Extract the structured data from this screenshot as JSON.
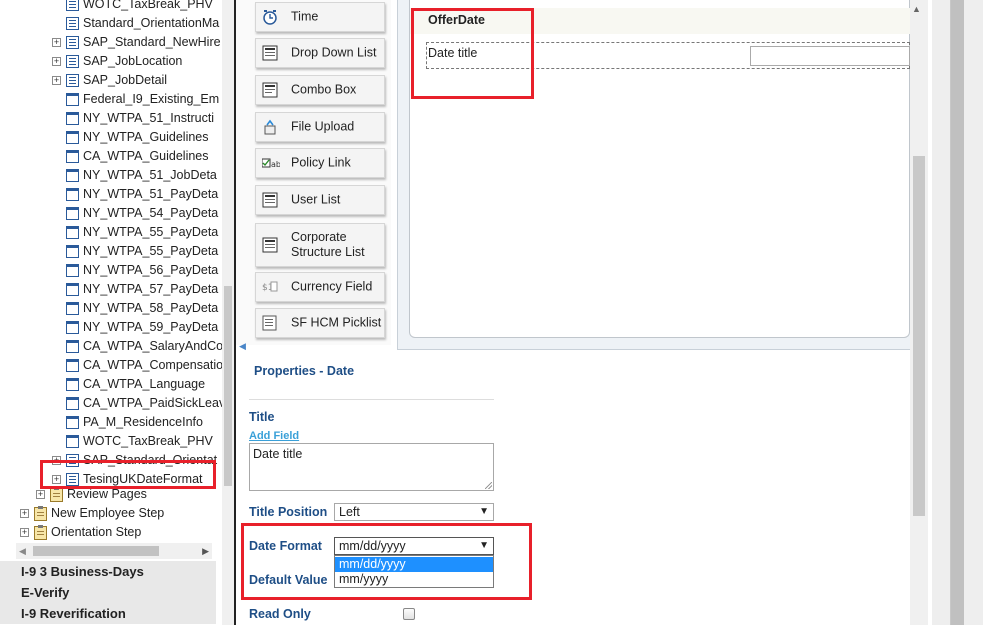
{
  "tree": {
    "items": [
      {
        "label": "WOTC_TaxBreak_PHV",
        "expander": false,
        "icon": "lined"
      },
      {
        "label": "Standard_OrientationMa",
        "expander": false,
        "icon": "lined"
      },
      {
        "label": "SAP_Standard_NewHire",
        "expander": true,
        "icon": "lined"
      },
      {
        "label": "SAP_JobLocation",
        "expander": true,
        "icon": "lined"
      },
      {
        "label": "SAP_JobDetail",
        "expander": true,
        "icon": "lined"
      },
      {
        "label": "Federal_I9_Existing_Em",
        "expander": false,
        "icon": "plain"
      },
      {
        "label": "NY_WTPA_51_Instructi",
        "expander": false,
        "icon": "plain"
      },
      {
        "label": "NY_WTPA_Guidelines",
        "expander": false,
        "icon": "plain"
      },
      {
        "label": "CA_WTPA_Guidelines",
        "expander": false,
        "icon": "plain"
      },
      {
        "label": "NY_WTPA_51_JobDeta",
        "expander": false,
        "icon": "plain"
      },
      {
        "label": "NY_WTPA_51_PayDeta",
        "expander": false,
        "icon": "plain"
      },
      {
        "label": "NY_WTPA_54_PayDeta",
        "expander": false,
        "icon": "plain"
      },
      {
        "label": "NY_WTPA_55_PayDeta",
        "expander": false,
        "icon": "plain"
      },
      {
        "label": "NY_WTPA_55_PayDeta",
        "expander": false,
        "icon": "plain"
      },
      {
        "label": "NY_WTPA_56_PayDeta",
        "expander": false,
        "icon": "plain"
      },
      {
        "label": "NY_WTPA_57_PayDeta",
        "expander": false,
        "icon": "plain"
      },
      {
        "label": "NY_WTPA_58_PayDeta",
        "expander": false,
        "icon": "plain"
      },
      {
        "label": "NY_WTPA_59_PayDeta",
        "expander": false,
        "icon": "plain"
      },
      {
        "label": "CA_WTPA_SalaryAndCo",
        "expander": false,
        "icon": "plain"
      },
      {
        "label": "CA_WTPA_Compensatio",
        "expander": false,
        "icon": "plain"
      },
      {
        "label": "CA_WTPA_Language",
        "expander": false,
        "icon": "plain"
      },
      {
        "label": "CA_WTPA_PaidSickLeav",
        "expander": false,
        "icon": "plain"
      },
      {
        "label": "PA_M_ResidenceInfo",
        "expander": false,
        "icon": "plain"
      },
      {
        "label": "WOTC_TaxBreak_PHV",
        "expander": false,
        "icon": "plain"
      },
      {
        "label": "SAP_Standard_Orientat",
        "expander": true,
        "icon": "lined"
      },
      {
        "label": "TesingUKDateFormat",
        "expander": true,
        "icon": "lined"
      }
    ],
    "review_pages": "Review Pages",
    "new_employee_step": "New Employee Step",
    "orientation_step": "Orientation Step",
    "expander_symbol": "+"
  },
  "accordion": [
    "I-9 3 Business-Days",
    "E-Verify",
    "I-9 Reverification"
  ],
  "palette": {
    "items": [
      {
        "label": "Time",
        "icon": "clock-icon"
      },
      {
        "label": "Drop Down List",
        "icon": "dropdown-list-icon"
      },
      {
        "label": "Combo Box",
        "icon": "combo-box-icon"
      },
      {
        "label": "File Upload",
        "icon": "file-upload-icon"
      },
      {
        "label": "Policy Link",
        "icon": "policy-link-icon"
      },
      {
        "label": "User List",
        "icon": "user-list-icon"
      },
      {
        "label": "Corporate Structure List",
        "icon": "corporate-structure-icon"
      },
      {
        "label": "Currency Field",
        "icon": "currency-field-icon"
      },
      {
        "label": "SF HCM Picklist",
        "icon": "picklist-icon"
      }
    ]
  },
  "canvas": {
    "section_title": "OfferDate",
    "field_label": "Date title"
  },
  "properties": {
    "heading": "Properties - Date",
    "title_label": "Title",
    "add_field_link": "Add Field",
    "title_value": "Date title",
    "title_position_label": "Title Position",
    "title_position_value": "Left",
    "date_format_label": "Date Format",
    "date_format_value": "mm/dd/yyyy",
    "date_format_options": [
      "mm/dd/yyyy",
      "mm/yyyy"
    ],
    "default_value_label": "Default Value",
    "read_only_label": "Read Only"
  },
  "colors": {
    "highlight": "#e8202a",
    "label_blue": "#1e4e86",
    "selected_option": "#1e90ff"
  }
}
